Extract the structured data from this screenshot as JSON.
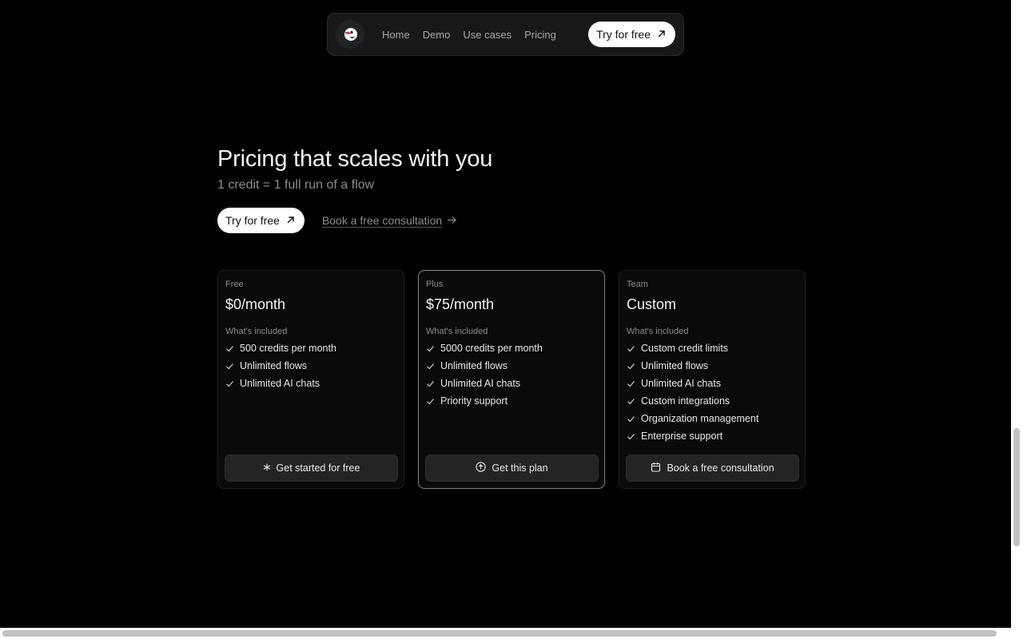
{
  "nav": {
    "links": [
      "Home",
      "Demo",
      "Use cases",
      "Pricing"
    ],
    "cta_label": "Try for free"
  },
  "hero": {
    "title": "Pricing that scales with you",
    "subtitle": "1 credit = 1 full run of a flow",
    "cta_label": "Try for free",
    "consult_label": "Book a free consultation"
  },
  "included_label": "What's included",
  "plans": [
    {
      "name": "Free",
      "price": "$0/month",
      "features": [
        "500 credits per month",
        "Unlimited flows",
        "Unlimited AI chats"
      ],
      "button_label": "Get started for free",
      "button_icon": "asterisk-icon"
    },
    {
      "name": "Plus",
      "price": "$75/month",
      "features": [
        "5000 credits per month",
        "Unlimited flows",
        "Unlimited AI chats",
        "Priority support"
      ],
      "button_label": "Get this plan",
      "button_icon": "arrow-up-circle-icon"
    },
    {
      "name": "Team",
      "price": "Custom",
      "features": [
        "Custom credit limits",
        "Unlimited flows",
        "Unlimited AI chats",
        "Custom integrations",
        "Organization management",
        "Enterprise support"
      ],
      "button_label": "Book a free consultation",
      "button_icon": "calendar-icon"
    }
  ],
  "colors": {
    "background": "#000000",
    "card": "#0a0a0b",
    "button": "#242426",
    "accent_white": "#ffffff",
    "muted_text": "#8d8d91"
  }
}
